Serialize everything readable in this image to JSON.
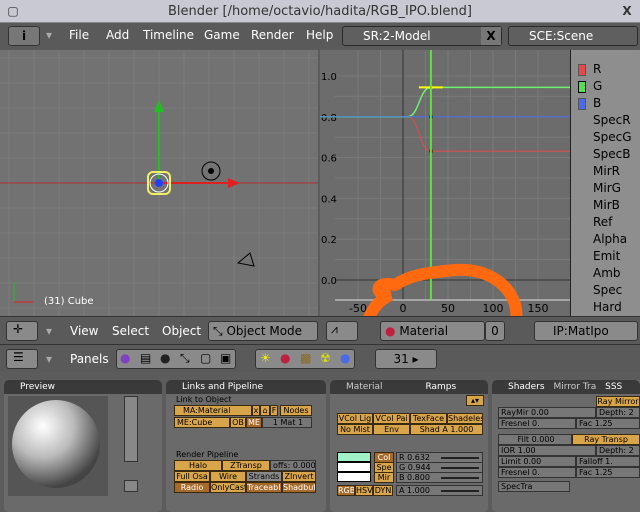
{
  "window": {
    "title": "Blender [/home/octavio/hadita/RGB_IPO.blend]",
    "close": "X"
  },
  "menubar": {
    "items": [
      "File",
      "Add",
      "Timeline",
      "Game",
      "Render",
      "Help"
    ],
    "screen": "SR:2-Model",
    "screen_close": "X",
    "scene": "SCE:Scene"
  },
  "view3d": {
    "label": "(31) Cube",
    "header": {
      "items": [
        "View",
        "Select",
        "Object"
      ],
      "mode": "Object Mode"
    }
  },
  "ipo": {
    "yticks": [
      "1.0",
      "0.8",
      "0.6",
      "0.4",
      "0.2",
      "0.0"
    ],
    "xticks": [
      "-50",
      "0",
      "50",
      "100",
      "150"
    ],
    "channels": [
      {
        "name": "R",
        "color": "#e84848"
      },
      {
        "name": "G",
        "color": "#50e050"
      },
      {
        "name": "B",
        "color": "#4a6ae8"
      },
      {
        "name": "SpecR"
      },
      {
        "name": "SpecG"
      },
      {
        "name": "SpecB"
      },
      {
        "name": "MirR"
      },
      {
        "name": "MirG"
      },
      {
        "name": "MirB"
      },
      {
        "name": "Ref"
      },
      {
        "name": "Alpha"
      },
      {
        "name": "Emit"
      },
      {
        "name": "Amb"
      },
      {
        "name": "Spec"
      },
      {
        "name": "Hard"
      }
    ],
    "curves": [
      {
        "name": "R",
        "from": [
          5,
          0.8
        ],
        "to": [
          31,
          0.632
        ],
        "color": "#e84848"
      },
      {
        "name": "G",
        "from": [
          5,
          0.8
        ],
        "to": [
          31,
          0.944
        ],
        "color": "#70f070"
      },
      {
        "name": "B",
        "from": [
          5,
          0.8
        ],
        "to": [
          31,
          0.8
        ],
        "color": "#4a6ae8"
      }
    ],
    "current_frame": 31,
    "header": {
      "type": "Material",
      "index": "0",
      "block": "IP:MatIpo"
    }
  },
  "buttons_header": {
    "panels": "Panels",
    "frame": "31"
  },
  "preview": {
    "title": "Preview"
  },
  "links": {
    "title": "Links and Pipeline",
    "link_to_object": "Link to Object",
    "ma": "MA:Material",
    "x": "x",
    "f": "F",
    "nodes": "Nodes",
    "me": "ME:Cube",
    "ob": "OB",
    "me_btn": "ME",
    "mat": "1 Mat 1",
    "render_pipeline": "Render Pipeline",
    "pipeline": [
      "Halo",
      "ZTransp",
      "offs: 0.000",
      "Full Osa",
      "Wire",
      "Strands",
      "ZInvert",
      "Radio",
      "OnlyCast",
      "Traceable",
      "Shadbuf"
    ]
  },
  "material": {
    "tabs": [
      "Material",
      "Ramps"
    ],
    "row1": [
      "VCol Lig",
      "VCol Pai",
      "TexFace",
      "Shadeles"
    ],
    "row2": [
      "No Mist",
      "Env",
      "Shad A 1.000"
    ],
    "color_btns": [
      "Col",
      "Spe",
      "Mir"
    ],
    "rgb": [
      "R 0.632",
      "G 0.944",
      "B 0.800"
    ],
    "modes": [
      "RGB",
      "HSV",
      "DYN"
    ],
    "alpha": "A 1.000",
    "swatch": "#a0f0c8",
    "slider_values": [
      0.632,
      0.944,
      0.8,
      1.0
    ]
  },
  "shaders": {
    "tabs": [
      "Shaders",
      "Mirror Tra",
      "SSS"
    ],
    "ray_mirror": "Ray Mirror",
    "raymir": "RayMir 0.00",
    "depth1": "Depth: 2",
    "fresnel1": "Fresnel 0.",
    "fac1": "Fac 1.25",
    "filt": "Filt 0.000",
    "ray_transp": "Ray Transp",
    "ior": "IOR 1.00",
    "depth2": "Depth: 2",
    "limit": "Limit 0.00",
    "falloff": "Falloff 1.",
    "fresnel2": "Fresnel 0.",
    "fac2": "Fac 1.25",
    "spectra": "SpecTra"
  },
  "colors": {
    "annotation": "#ff6a10",
    "button": "#d9a54a"
  }
}
